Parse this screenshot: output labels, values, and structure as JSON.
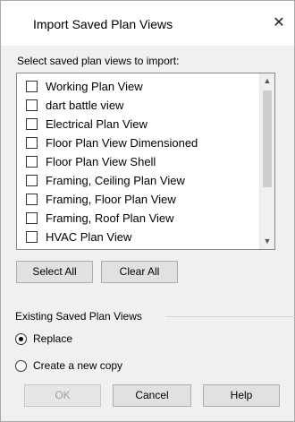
{
  "dialog": {
    "title": "Import Saved Plan Views",
    "close_glyph": "✕"
  },
  "prompt": "Select saved plan views to import:",
  "views": [
    {
      "label": " Working Plan View",
      "checked": false
    },
    {
      "label": "dart battle view",
      "checked": false
    },
    {
      "label": "Electrical Plan View",
      "checked": false
    },
    {
      "label": "Floor Plan View Dimensioned",
      "checked": false
    },
    {
      "label": "Floor Plan View Shell",
      "checked": false
    },
    {
      "label": "Framing, Ceiling Plan View",
      "checked": false
    },
    {
      "label": "Framing, Floor Plan View",
      "checked": false
    },
    {
      "label": "Framing, Roof Plan View",
      "checked": false
    },
    {
      "label": "HVAC Plan View",
      "checked": false
    }
  ],
  "scrollbar": {
    "up_glyph": "▲",
    "down_glyph": "▼"
  },
  "buttons": {
    "select_all": "Select All",
    "clear_all": "Clear All",
    "ok": "OK",
    "cancel": "Cancel",
    "help": "Help"
  },
  "existing": {
    "group_label": "Existing Saved Plan Views",
    "options": [
      {
        "label": "Replace",
        "selected": true
      },
      {
        "label": "Create a new copy",
        "selected": false
      }
    ]
  }
}
